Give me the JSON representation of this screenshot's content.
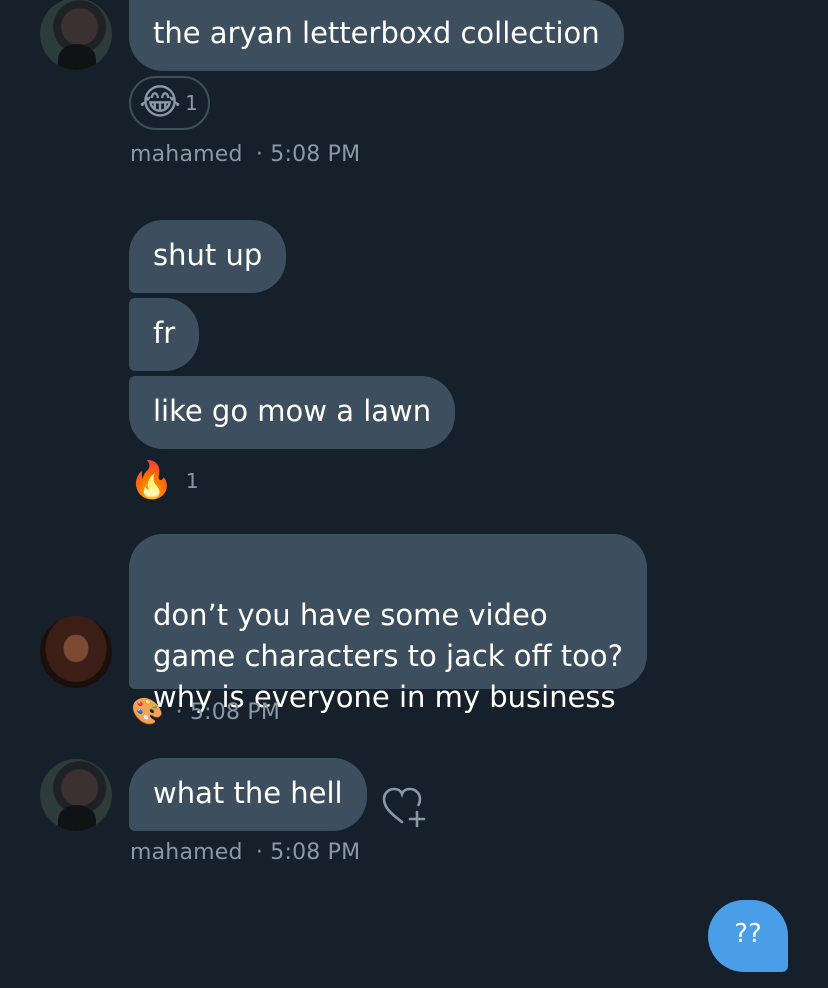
{
  "messages": [
    {
      "text": "the aryan letterboxd collection"
    },
    {
      "text": "shut up"
    },
    {
      "text": "fr"
    },
    {
      "text": "like go mow a lawn"
    },
    {
      "text": "don’t you have some video\ngame characters to jack off too?\nwhy is everyone in my business"
    },
    {
      "text": "what the hell"
    },
    {
      "text": "??"
    }
  ],
  "reactions": {
    "laugh": {
      "emoji": "😂",
      "count": "1"
    },
    "fire": {
      "emoji": "🔥",
      "count": "1"
    },
    "palette": {
      "emoji": "🎨"
    }
  },
  "meta": {
    "m1_name": "mahamed",
    "m1_time": "· 5:08 PM",
    "f_time": "· 5:08 PM",
    "m2_name": "mahamed",
    "m2_time": "· 5:08 PM"
  },
  "colors": {
    "background": "#15202b",
    "received_bubble": "#3d4f5f",
    "sent_bubble": "#4a9ee8",
    "meta_text": "#8b98a5"
  },
  "icons": {
    "add_reaction": "heart-plus-icon"
  }
}
